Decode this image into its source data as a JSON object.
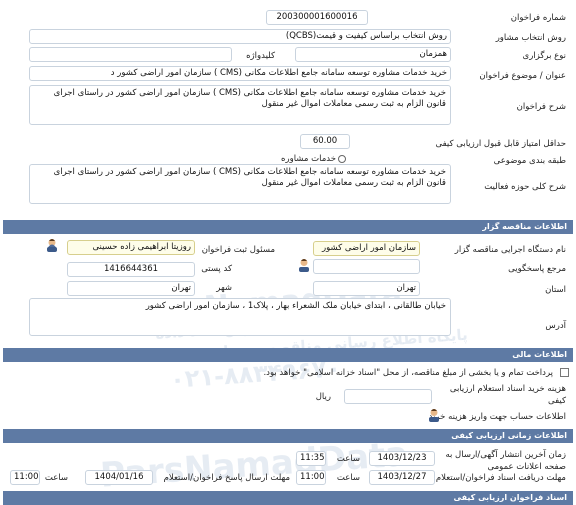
{
  "labels": {
    "number": "شماره فراخوان",
    "method": "روش انتخاب مشاور",
    "hold_type": "نوع برگزاری",
    "title": "عنوان / موضوع فراخوان",
    "description": "شرح فراخوان",
    "min_score": "حداقل امتياز قابل قبول ارزيابی کيفی",
    "classification": "طبقه بندی موضوعی",
    "activity": "شرح کلی حوزه فعاليت"
  },
  "tender": {
    "number": "200300001600016",
    "method": "روش انتخاب براساس کيفيت و قيمت(QCBS)",
    "hold_type": "همزمان",
    "keyword_label": "کليدواژه",
    "keyword": "",
    "title": "خريد خدمات مشاوره توسعه سامانه جامع اطلاعات مکانی (CMS ) سازمان امور اراضی کشور د",
    "description": "خريد خدمات مشاوره توسعه سامانه جامع اطلاعات مکانی (CMS ) سازمان امور اراضی کشور در راستای اجرای قانون الزام به ثبت رسمی معاملات اموال غير منقول",
    "min_score": "60.00",
    "classification": "خدمات مشاوره",
    "activity": "خريد خدمات مشاوره توسعه سامانه جامع اطلاعات مکانی (CMS ) سازمان امور اراضی کشور در راستای اجرای قانون الزام به ثبت رسمی معاملات اموال غير منقول"
  },
  "organizer": {
    "section_title": "اطلاعات مناقصه گزار",
    "org_label": "نام دستگاه اجرايی مناقصه گزار",
    "org": "سازمان امور اراضی کشور",
    "registrar_label": "مسئول ثبت فراخوان",
    "registrar": "روزيتا ابراهيمی زاده حسينی",
    "reference_label": "مرجع پاسخگويی",
    "reference": "",
    "postal_label": "کد پستی",
    "postal": "1416644361",
    "province_label": "استان",
    "province": "تهران",
    "city_label": "شهر",
    "city": "تهران",
    "address_label": "آدرس",
    "address": "خيابان طالقانی ، ابتدای خيابان ملک الشعراء بهار ، پلاک1 ، سازمان امور اراضی کشور"
  },
  "financial": {
    "section_title": "اطلاعات مالی",
    "payment_text": "پرداخت تمام و يا بخشی از مبلغ مناقصه، از محل \"اسناد خزانه اسلامی\" خواهد بود.",
    "doc_fee_label": "هزينه خريد اسناد استعلام ارزيابی کيفی",
    "currency": "ريال",
    "account_label": "اطلاعات حساب جهت واريز هزينه خريد"
  },
  "timing": {
    "section_title": "اطلاعات زمانی ارزيابی کيفی",
    "publish_label": "زمان آخرين انتشار آگهی/ارسال به صفحه اعلانات عمومی",
    "publish_date": "1403/12/23",
    "publish_time": "11:35",
    "doc_deadline_label": "مهلت دريافت اسناد فراخوان/استعلام",
    "doc_deadline_date": "1403/12/27",
    "doc_deadline_time": "11:00",
    "response_deadline_label": "مهلت ارسال پاسخ فراخوان/استعلام",
    "response_deadline_date": "1404/01/16",
    "response_deadline_time": "11:00",
    "time_label": "ساعت"
  },
  "footer": {
    "section_title": "اسناد فراخوان ارزيابی کيفی"
  },
  "watermark": {
    "brand": "ParsNamadData",
    "tagline": "پايگاه اطلاع رسانی مناقصه و مزايده",
    "phone": "۰۲۱-۸۸۳۴۹۶۷۰",
    "persian_line": "مرکز فراوری اطلاعات پارس نماد داده"
  },
  "colors": {
    "section_header": "#5e7aa4",
    "highlight_field": "#fefde9",
    "watermark": "#8caac8"
  }
}
